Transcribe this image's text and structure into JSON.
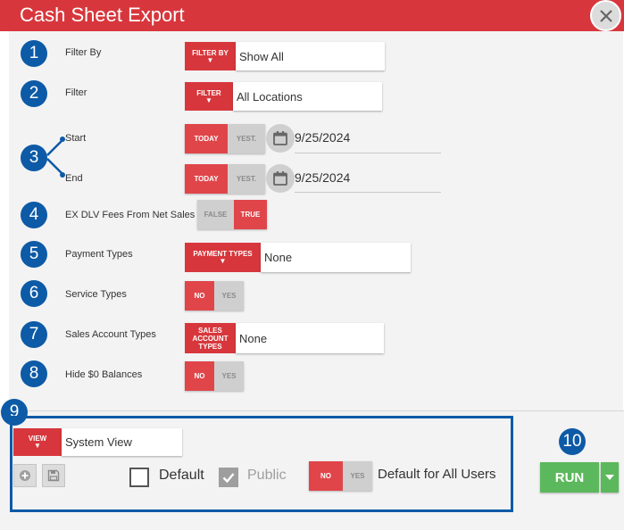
{
  "window": {
    "title": "Cash Sheet Export",
    "close_icon": "close-icon"
  },
  "badges": [
    "1",
    "2",
    "3",
    "4",
    "5",
    "6",
    "7",
    "8",
    "9",
    "10"
  ],
  "fields": {
    "filter_by": {
      "label": "Filter By",
      "tag": "FILTER BY",
      "value": "Show All"
    },
    "filter": {
      "label": "Filter",
      "tag": "FILTER",
      "value": "All Locations"
    },
    "start": {
      "label": "Start",
      "today": "TODAY",
      "yest": "YEST.",
      "date": "9/25/2024"
    },
    "end": {
      "label": "End",
      "today": "TODAY",
      "yest": "YEST.",
      "date": "9/25/2024"
    },
    "ex_dlv": {
      "label": "EX DLV Fees From Net Sales",
      "false_label": "FALSE",
      "true_label": "TRUE",
      "selected": "TRUE"
    },
    "payment_types": {
      "label": "Payment Types",
      "tag": "PAYMENT TYPES",
      "value": "None"
    },
    "service_types": {
      "label": "Service Types",
      "no": "NO",
      "yes": "YES",
      "selected": "NO"
    },
    "sales_account_types": {
      "label": "Sales Account Types",
      "tag_lines": [
        "SALES",
        "ACCOUNT",
        "TYPES"
      ],
      "value": "None"
    },
    "hide_zero": {
      "label": "Hide $0 Balances",
      "no": "NO",
      "yes": "YES",
      "selected": "NO"
    }
  },
  "view": {
    "tag": "VIEW",
    "value": "System View",
    "default_label": "Default",
    "default_checked": false,
    "public_label": "Public",
    "public_checked": true,
    "all_users_no": "NO",
    "all_users_yes": "YES",
    "all_users_selected": "NO",
    "all_users_label": "Default for All Users"
  },
  "actions": {
    "run_label": "RUN"
  },
  "colors": {
    "accent_red": "#d7373c",
    "badge_blue": "#0d5aa7",
    "run_green": "#5cb85c"
  }
}
